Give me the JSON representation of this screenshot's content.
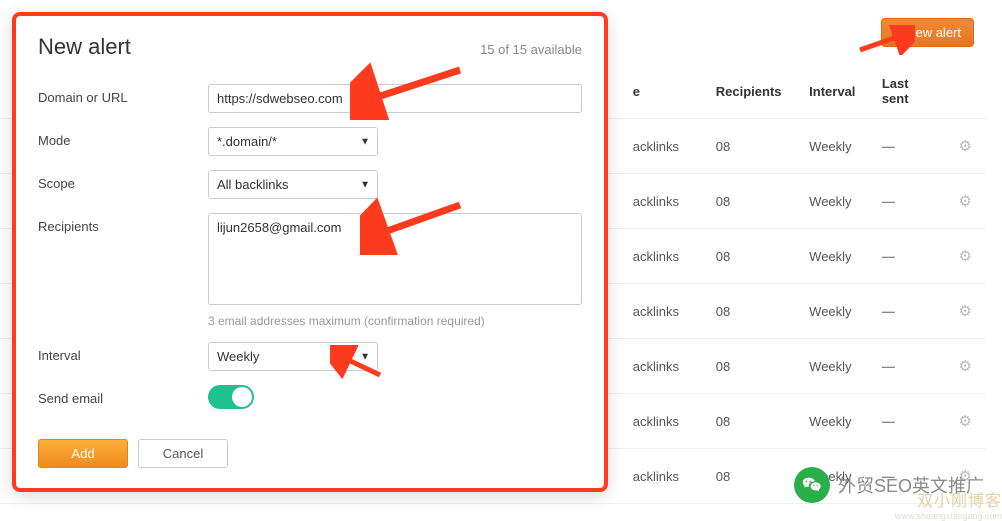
{
  "header": {
    "new_alert_btn": "New alert"
  },
  "table": {
    "cols": {
      "domain": "",
      "scope": "e",
      "recipients": "Recipients",
      "interval": "Interval",
      "last_sent": "Last sent"
    },
    "rows": [
      {
        "scope": "acklinks",
        "recipients": "08",
        "interval": "Weekly",
        "last_sent": "—"
      },
      {
        "scope": "acklinks",
        "recipients": "08",
        "interval": "Weekly",
        "last_sent": "—"
      },
      {
        "scope": "acklinks",
        "recipients": "08",
        "interval": "Weekly",
        "last_sent": "—"
      },
      {
        "scope": "acklinks",
        "recipients": "08",
        "interval": "Weekly",
        "last_sent": "—"
      },
      {
        "scope": "acklinks",
        "recipients": "08",
        "interval": "Weekly",
        "last_sent": "—"
      },
      {
        "scope": "acklinks",
        "recipients": "08",
        "interval": "Weekly",
        "last_sent": "—"
      },
      {
        "scope": "acklinks",
        "recipients": "08",
        "interval": "Weekly",
        "last_sent": "—"
      }
    ]
  },
  "modal": {
    "title": "New alert",
    "subtitle": "15 of 15 available",
    "fields": {
      "domain_label": "Domain or URL",
      "domain_value": "https://sdwebseo.com",
      "mode_label": "Mode",
      "mode_value": "*.domain/*",
      "scope_label": "Scope",
      "scope_value": "All backlinks",
      "recipients_label": "Recipients",
      "recipients_value": "lijun2658@gmail.com",
      "recipients_hint": "3 email addresses maximum (confirmation required)",
      "interval_label": "Interval",
      "interval_value": "Weekly",
      "send_email_label": "Send email",
      "send_email_on": true
    },
    "actions": {
      "add": "Add",
      "cancel": "Cancel"
    }
  },
  "watermark": {
    "text": "外贸SEO英文推广",
    "blog": "双小刚博客",
    "blog_url": "www.shuangxiaogang.com"
  },
  "colors": {
    "arrow": "#ff3b1f",
    "accent_orange": "#f08a1e",
    "toggle_green": "#1fc18e"
  }
}
